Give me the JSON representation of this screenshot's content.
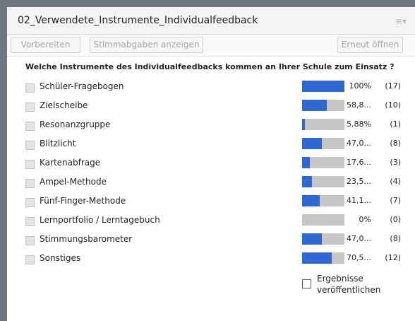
{
  "window": {
    "title": "02_Verwendete_Instrumente_Individualfeedback",
    "menu_icon": "≡▾"
  },
  "toolbar": {
    "prepare_label": "Vorbereiten",
    "show_votes_label": "Stimmabgaben anzeigen",
    "reopen_label": "Erneut öffnen"
  },
  "poll": {
    "question": "Welche Instrumente des Individualfeedbacks kommen an Ihrer Schule zum Einsatz ?",
    "options": [
      {
        "label": "Schüler-Fragebogen",
        "percent_text": "100%",
        "count_text": "(17)",
        "fraction": 1.0
      },
      {
        "label": "Zielscheibe",
        "percent_text": "58,8...",
        "count_text": "(10)",
        "fraction": 0.588
      },
      {
        "label": "Resonanzgruppe",
        "percent_text": "5,88%",
        "count_text": "(1)",
        "fraction": 0.0588
      },
      {
        "label": "Blitzlicht",
        "percent_text": "47,0...",
        "count_text": "(8)",
        "fraction": 0.47
      },
      {
        "label": "Kartenabfrage",
        "percent_text": "17,6...",
        "count_text": "(3)",
        "fraction": 0.176
      },
      {
        "label": "Ampel-Methode",
        "percent_text": "23,5...",
        "count_text": "(4)",
        "fraction": 0.235
      },
      {
        "label": "Fünf-Finger-Methode",
        "percent_text": "41,1...",
        "count_text": "(7)",
        "fraction": 0.411
      },
      {
        "label": "Lernportfolio / Lerntagebuch",
        "percent_text": "0%",
        "count_text": "(0)",
        "fraction": 0.0
      },
      {
        "label": "Stimmungsbarometer",
        "percent_text": "47,0...",
        "count_text": "(8)",
        "fraction": 0.47
      },
      {
        "label": "Sonstiges",
        "percent_text": "70,5...",
        "count_text": "(12)",
        "fraction": 0.705
      }
    ]
  },
  "publish": {
    "line1": "Ergebnisse",
    "line2": "veröffentlichen"
  },
  "colors": {
    "bar_fill": "#2f68d0",
    "bar_track": "#c6c6c6"
  }
}
